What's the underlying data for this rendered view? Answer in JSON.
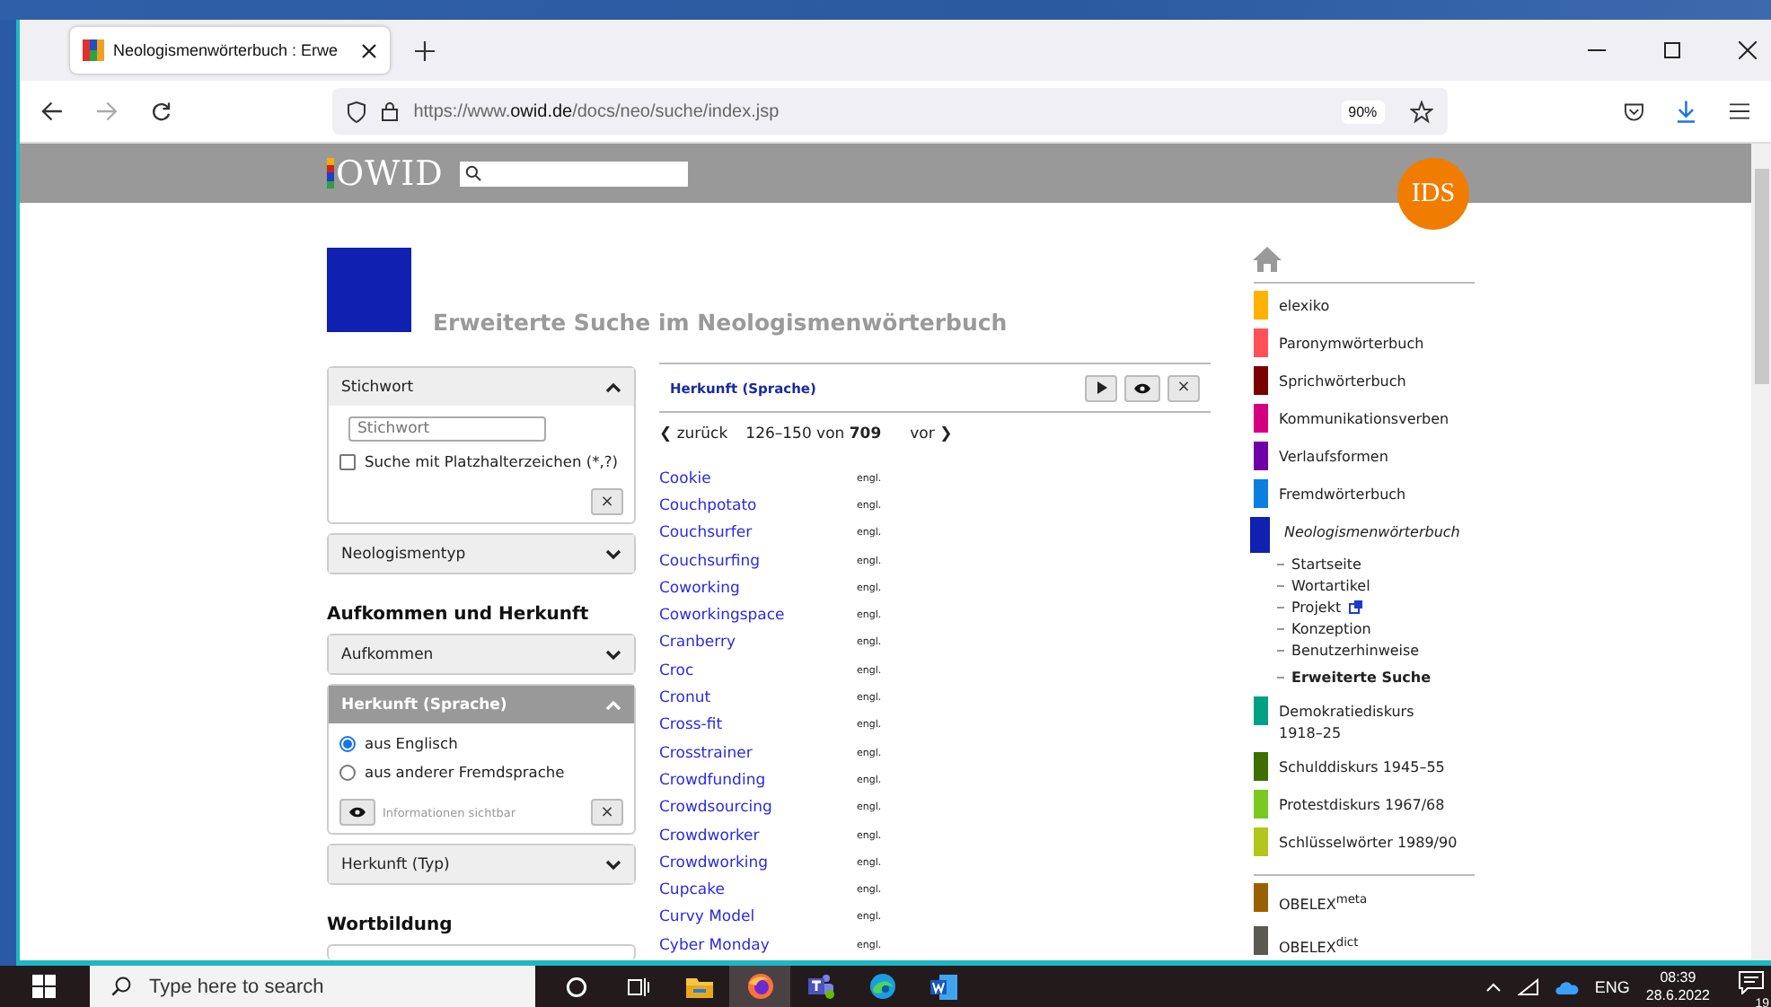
{
  "browser": {
    "tab_title": "Neologismenwörterbuch : Erwe",
    "url_prefix": "https://www.",
    "url_domain": "owid.de",
    "url_path": "/docs/neo/suche/index.jsp",
    "zoom": "90%"
  },
  "site_header": {
    "logo": "OWID",
    "badge": "IDS"
  },
  "page_title": "Erweiterte Suche im Neologismenwörterbuch",
  "filters": [
    {
      "kind": "panel",
      "title": "Stichwort",
      "expanded": true,
      "active": false,
      "placeholder": "Stichwort",
      "checkbox": {
        "label": "Suche mit Platzhalterzeichen (*,?)",
        "checked": false
      },
      "clear": "×"
    },
    {
      "kind": "panel",
      "title": "Neologismentyp",
      "expanded": false,
      "active": false
    },
    {
      "kind": "heading",
      "title": "Aufkommen und Herkunft"
    },
    {
      "kind": "panel",
      "title": "Aufkommen",
      "expanded": false,
      "active": false
    },
    {
      "kind": "panel",
      "title": "Herkunft (Sprache)",
      "expanded": true,
      "active": true,
      "radios": [
        {
          "label": "aus Englisch",
          "selected": true
        },
        {
          "label": "aus anderer Fremdsprache",
          "selected": false
        }
      ],
      "info": "Informationen sichtbar",
      "clear": "×"
    },
    {
      "kind": "panel",
      "title": "Herkunft (Typ)",
      "expanded": false,
      "active": false
    },
    {
      "kind": "heading",
      "title": "Wortbildung"
    },
    {
      "kind": "stub"
    }
  ],
  "results": {
    "title": "Herkunft (Sprache)",
    "close": "×",
    "prev": "❮ zurück",
    "range": "126–150 von **709**",
    "next": "vor ❯",
    "rows": [
      {
        "word": "Cookie",
        "origin": "engl."
      },
      {
        "word": "Couchpotato",
        "origin": "engl."
      },
      {
        "word": "Couchsurfer",
        "origin": "engl."
      },
      {
        "word": "Couchsurfing",
        "origin": "engl."
      },
      {
        "word": "Coworking",
        "origin": "engl."
      },
      {
        "word": "Coworkingspace",
        "origin": "engl."
      },
      {
        "word": "Cranberry",
        "origin": "engl."
      },
      {
        "word": "Croc",
        "origin": "engl."
      },
      {
        "word": "Cronut",
        "origin": "engl."
      },
      {
        "word": "Cross-fit",
        "origin": "engl."
      },
      {
        "word": "Crosstrainer",
        "origin": "engl."
      },
      {
        "word": "Crowdfunding",
        "origin": "engl."
      },
      {
        "word": "Crowdsourcing",
        "origin": "engl."
      },
      {
        "word": "Crowdworker",
        "origin": "engl."
      },
      {
        "word": "Crowdworking",
        "origin": "engl."
      },
      {
        "word": "Cupcake",
        "origin": "engl."
      },
      {
        "word": "Curvy Model",
        "origin": "engl."
      },
      {
        "word": "Cyber Monday",
        "origin": "engl."
      }
    ]
  },
  "dictionaries": [
    {
      "label": "elexiko",
      "color": "#ffb300",
      "selected": false
    },
    {
      "label": "Paronymwörterbuch",
      "color": "#ff5257",
      "selected": false
    },
    {
      "label": "Sprichwörterbuch",
      "color": "#7a0000",
      "selected": false
    },
    {
      "label": "Kommunikationsverben",
      "color": "#d4007f",
      "selected": false
    },
    {
      "label": "Verlaufsformen",
      "color": "#7000a8",
      "selected": false
    },
    {
      "label": "Fremdwörterbuch",
      "color": "#0a7fe0",
      "selected": false
    },
    {
      "label": "Neologismenwörterbuch",
      "color": "#1020b0",
      "selected": true,
      "children": [
        {
          "label": "Startseite",
          "selected": false,
          "external": false
        },
        {
          "label": "Wortartikel",
          "selected": false,
          "external": false
        },
        {
          "label": "Projekt",
          "selected": false,
          "external": true
        },
        {
          "label": "Konzeption",
          "selected": false,
          "external": false
        },
        {
          "label": "Benutzerhinweise",
          "selected": false,
          "external": false
        },
        {
          "label": "Erweiterte Suche",
          "selected": true,
          "external": false
        }
      ]
    },
    {
      "label": "Demokratiediskurs 1918–25",
      "color": "#00a084",
      "selected": false
    },
    {
      "label": "Schulddiskurs 1945–55",
      "color": "#3d6e00",
      "selected": false
    },
    {
      "label": "Protestdiskurs 1967/68",
      "color": "#7ac923",
      "selected": false
    },
    {
      "label": "Schlüsselwörter 1989/90",
      "color": "#b2c61c",
      "selected": false
    }
  ],
  "tools": [
    {
      "label": "OBELEX$^{meta}$",
      "color": "#9a6000"
    },
    {
      "label": "OBELEX$^{dict}$",
      "color": "#5a5a50"
    }
  ],
  "taskbar": {
    "search_placeholder": "Type here to search",
    "apps": [
      {
        "kind": "cortana",
        "selected": false
      },
      {
        "kind": "taskview",
        "selected": false
      },
      {
        "kind": "explorer",
        "selected": false
      },
      {
        "kind": "firefox",
        "selected": true
      },
      {
        "kind": "teams",
        "selected": false
      },
      {
        "kind": "edge",
        "selected": false
      },
      {
        "kind": "word",
        "selected": false
      }
    ],
    "language": "ENG",
    "time": "08:39",
    "date": "28.6.2022",
    "notifications": "19"
  }
}
